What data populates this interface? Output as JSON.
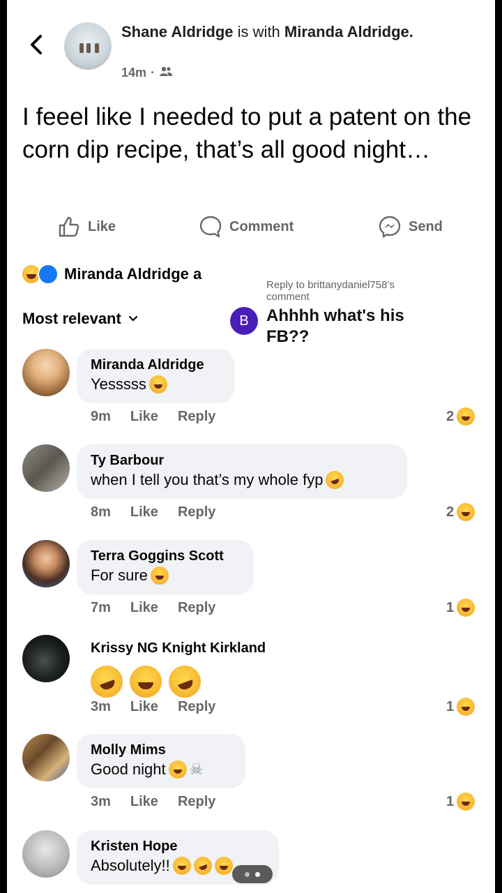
{
  "post": {
    "author": "Shane Aldridge",
    "with_text": "is with",
    "tagged": "Miranda Aldridge.",
    "time": "14m",
    "separator": "·",
    "audience_icon": "friends-icon",
    "text": "I feeel like I needed to put a patent on the corn dip recipe, that’s all good night…"
  },
  "actions": {
    "like": "Like",
    "comment": "Comment",
    "send": "Send"
  },
  "reactions_summary": {
    "names": "Miranda Aldridge a"
  },
  "sort": {
    "label": "Most relevant"
  },
  "reply_overlay": {
    "reply_to": "Reply to brittanydaniel758’s comment",
    "badge": "B",
    "text": "Ahhhh what's his FB??"
  },
  "comment_actions": {
    "like": "Like",
    "reply": "Reply"
  },
  "comments": [
    {
      "name": "Miranda Aldridge",
      "text": "Yesssss",
      "time": "9m",
      "count": "2"
    },
    {
      "name": "Ty Barbour",
      "text": "when I tell you that’s my whole fyp",
      "time": "8m",
      "count": "2"
    },
    {
      "name": "Terra Goggins Scott",
      "text": "For sure",
      "time": "7m",
      "count": "1"
    },
    {
      "name": "Krissy NG Knight Kirkland",
      "text": "",
      "time": "3m",
      "count": "1"
    },
    {
      "name": "Molly Mims",
      "text": "Good night",
      "time": "3m",
      "count": "1"
    },
    {
      "name": "Kristen Hope",
      "text": "Absolutely!!",
      "time": "",
      "count": ""
    }
  ],
  "colors": {
    "facebook_blue": "#1877f2",
    "bubble": "#f0f2f5",
    "badge": "#4a1fb8"
  }
}
